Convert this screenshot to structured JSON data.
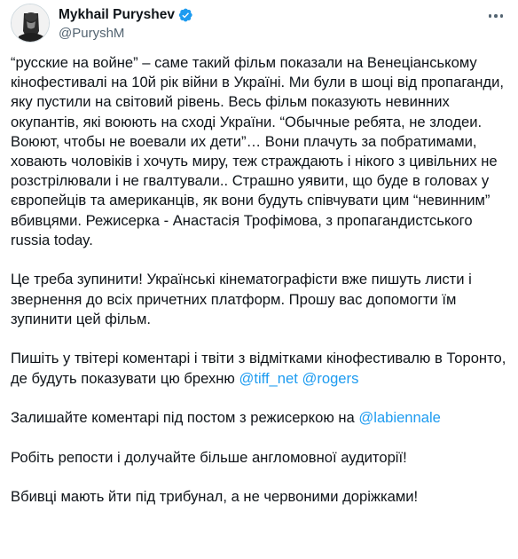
{
  "author": {
    "display_name": "Mykhail Puryshev",
    "handle": "@PuryshM",
    "avatar_icon": "avatar-photo",
    "verified_icon": "verified-badge-icon",
    "verified_color": "#1d9bf0"
  },
  "menu": {
    "icon": "more-options-icon"
  },
  "tweet": {
    "p1": [
      "“русские на войне” – саме такий фільм показали на Венеціанському кінофестивалі на 10й рік війни в Україні.",
      "Ми були в шоці від пропаганди, яку пустили на світовий рівень. Весь фільм показують невинних окупантів, які воюють на сході України.",
      "“Обычные ребята, не злодеи. Воюют, чтобы не воевали их дети”… Вони плачуть за побратимами, ховають чоловіків і хочуть миру, теж страждають і нікого з цивільних не розстрілювали і не гвалтували..",
      "Страшно уявити, що буде в головах у європейців та американців, як вони будуть співчувати цим “невинним” вбивцями.",
      "Режисерка - Анастасія Трофімова, з пропагандистського russia today."
    ],
    "p2": "Це треба зупинити! Українські кінематографісти вже пишуть листи і звернення до всіх причетних платформ. Прошу вас допомогти їм зупинити цей фільм.",
    "p3_text": "Пишіть у твітері коментарі і твіти з відмітками кінофестивалю в Торонто, де будуть показувати цю брехню ",
    "p3_mention_1": "@tiff_net",
    "p3_mention_2": "@rogers",
    "p4_text": "Залишайте коментарі під постом з режисеркою на ",
    "p4_mention": "@labiennale",
    "p5": "Робіть репости і долучайте більше англомовної аудиторії!",
    "p6": "Вбивці мають йти під трибунал, а не червоними доріжками!",
    "mention_color": "#1d9bf0"
  }
}
